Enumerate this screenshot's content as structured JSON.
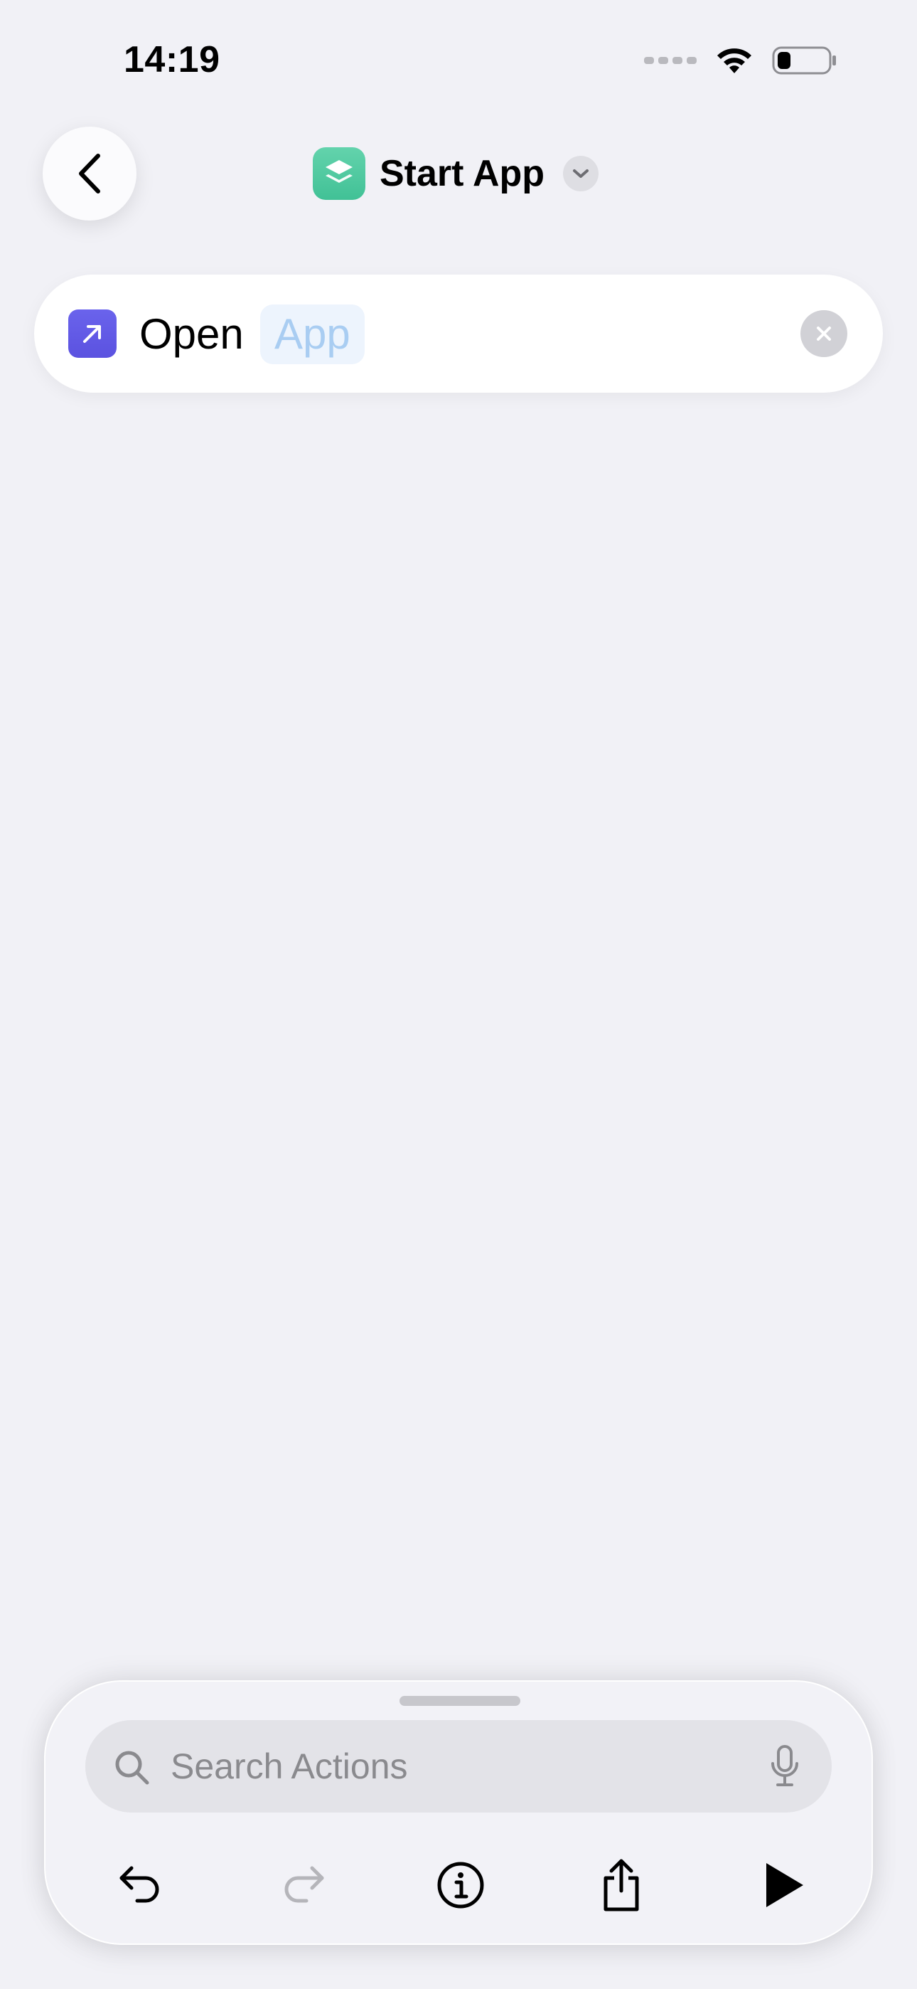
{
  "status_bar": {
    "time": "14:19",
    "icons": [
      "cellular-signal-icon",
      "wifi-icon",
      "battery-low-icon"
    ]
  },
  "nav": {
    "back_icon": "chevron-left-icon",
    "app_icon": "layers-icon",
    "app_icon_color": "#4fc9a0",
    "title": "Start App",
    "title_menu_icon": "chevron-down-icon"
  },
  "action": {
    "icon": "arrow-up-right-icon",
    "icon_color": "#5e56e6",
    "verb": "Open",
    "parameter_placeholder": "App",
    "remove_icon": "xmark-icon"
  },
  "bottom_sheet": {
    "search": {
      "placeholder": "Search Actions",
      "icon": "search-icon",
      "mic_icon": "microphone-icon"
    },
    "toolbar": [
      {
        "name": "undo",
        "icon": "undo-icon",
        "enabled": true
      },
      {
        "name": "redo",
        "icon": "redo-icon",
        "enabled": false
      },
      {
        "name": "info",
        "icon": "info-icon",
        "enabled": true
      },
      {
        "name": "share",
        "icon": "share-icon",
        "enabled": true
      },
      {
        "name": "run",
        "icon": "play-icon",
        "enabled": true
      }
    ]
  },
  "colors": {
    "background": "#f1f1f6",
    "accent_blue_placeholder": "#a9cdf2",
    "disabled": "#b5b5ba"
  }
}
